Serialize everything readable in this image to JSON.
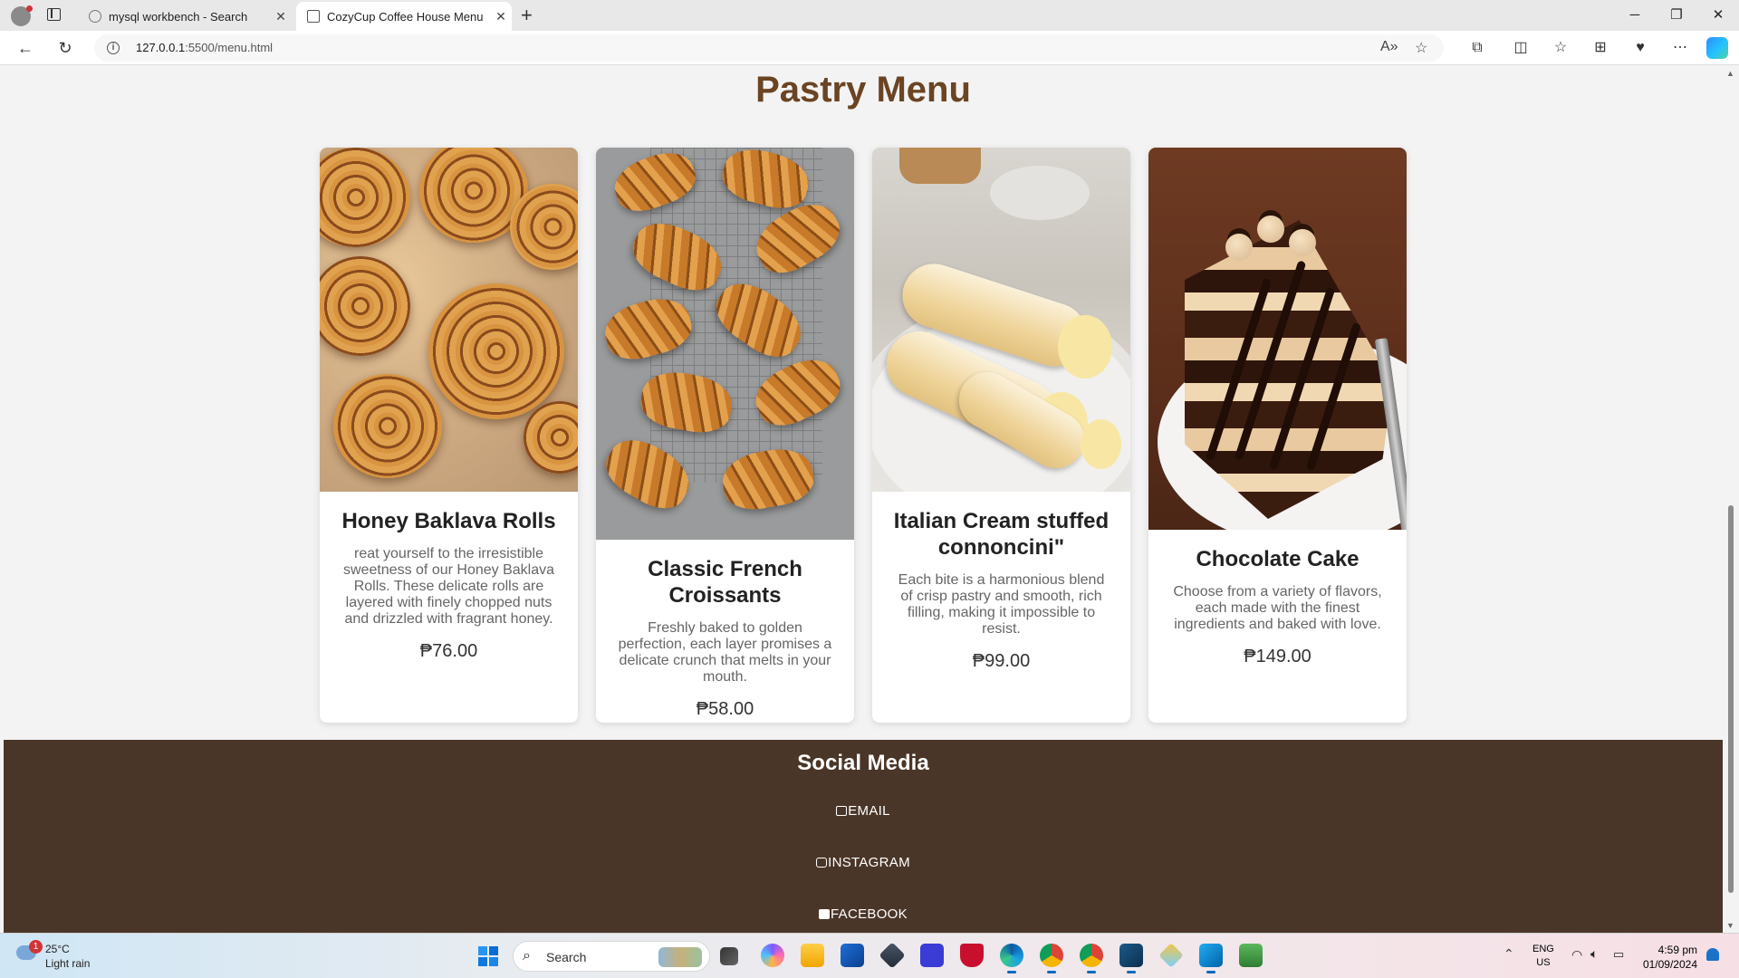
{
  "browser": {
    "tabs": [
      {
        "title": "mysql workbench - Search",
        "active": false
      },
      {
        "title": "CozyCup Coffee House Menu",
        "active": true
      }
    ],
    "url_host": "127.0.0.1",
    "url_path": ":5500/menu.html"
  },
  "page": {
    "title": "Pastry Menu",
    "items": [
      {
        "name": "Honey Baklava Rolls",
        "description": "reat yourself to the irresistible sweetness of our Honey Baklava Rolls. These delicate rolls are layered with finely chopped nuts and drizzled with fragrant honey.",
        "price": "₱76.00",
        "image": "baklava-rolls-photo"
      },
      {
        "name": "Classic French Croissants",
        "description": "Freshly baked to golden perfection, each layer promises a delicate crunch that melts in your mouth.",
        "price": "₱58.00",
        "image": "croissants-photo"
      },
      {
        "name": "Italian Cream stuffed connoncini\"",
        "description": "Each bite is a harmonious blend of crisp pastry and smooth, rich filling, making it impossible to resist.",
        "price": "₱99.00",
        "image": "cannoli-photo"
      },
      {
        "name": "Chocolate Cake",
        "description": "Choose from a variety of flavors, each made with the finest ingredients and baked with love.",
        "price": "₱149.00",
        "image": "chocolate-cake-photo"
      }
    ]
  },
  "footer": {
    "heading": "Social Media",
    "links": [
      "EMAIL",
      "INSTAGRAM",
      "FACEBOOK"
    ]
  },
  "taskbar": {
    "weather_badge": "1",
    "temperature": "25°C",
    "condition": "Light rain",
    "search_placeholder": "Search",
    "lang_line1": "ENG",
    "lang_line2": "US",
    "time": "4:59 pm",
    "date": "01/09/2024"
  },
  "colors": {
    "title": "#6b4423",
    "footer_bg": "#4a3628",
    "page_bg": "#f3f3f3"
  }
}
